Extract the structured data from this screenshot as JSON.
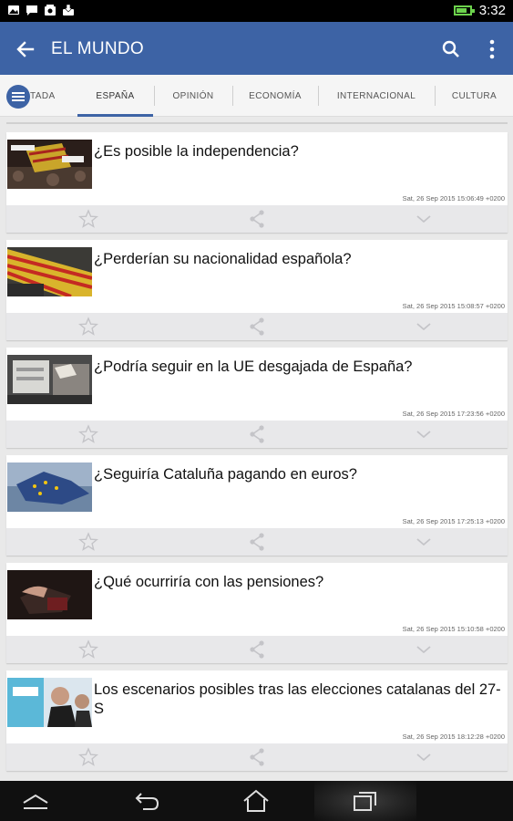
{
  "status_bar": {
    "time": "3:32",
    "battery_level": 0.8,
    "notification_icons": [
      "image-icon",
      "chat-icon",
      "photo-icon",
      "download-icon"
    ]
  },
  "app_bar": {
    "title": "EL MUNDO",
    "color": "#3d63a5"
  },
  "tabs": [
    {
      "label": "TADA",
      "active": false
    },
    {
      "label": "ESPAÑA",
      "active": true
    },
    {
      "label": "OPINIÓN",
      "active": false
    },
    {
      "label": "ECONOMÍA",
      "active": false
    },
    {
      "label": "INTERNACIONAL",
      "active": false
    },
    {
      "label": "CULTURA",
      "active": false
    }
  ],
  "articles": [
    {
      "title": "¿Es posible la independencia?",
      "date": "Sat, 26 Sep 2015 15:06:49 +0200"
    },
    {
      "title": "¿Perderían su nacionalidad española?",
      "date": "Sat, 26 Sep 2015 15:08:57 +0200"
    },
    {
      "title": "¿Podría seguir en la UE desgajada de España?",
      "date": "Sat, 26 Sep 2015 17:23:56 +0200"
    },
    {
      "title": "¿Seguiría Cataluña pagando en euros?",
      "date": "Sat, 26 Sep 2015 17:25:13 +0200"
    },
    {
      "title": "¿Qué ocurriría con las pensiones?",
      "date": "Sat, 26 Sep 2015 15:10:58 +0200"
    },
    {
      "title": "Los escenarios posibles tras las elecciones catalanas del 27-S",
      "date": "Sat, 26 Sep 2015 18:12:28 +0200"
    }
  ]
}
